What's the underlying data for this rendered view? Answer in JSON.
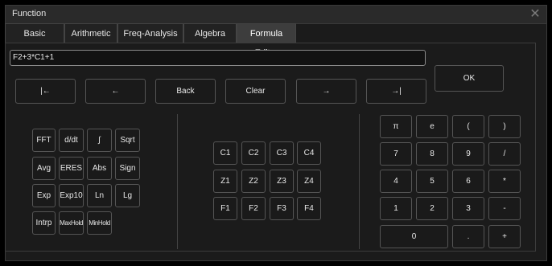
{
  "window": {
    "title": "Function",
    "close_glyph": "✕"
  },
  "tabs": [
    {
      "label": "Basic"
    },
    {
      "label": "Arithmetic"
    },
    {
      "label": "Freq-Analysis"
    },
    {
      "label": "Algebra"
    },
    {
      "label": "Formula Editor"
    }
  ],
  "active_tab": "Formula Editor",
  "expression": {
    "value": "F2+3*C1+1"
  },
  "edit_buttons": [
    {
      "label": "|←"
    },
    {
      "label": "←"
    },
    {
      "label": "Back"
    },
    {
      "label": "Clear"
    },
    {
      "label": "→"
    },
    {
      "label": "→|"
    }
  ],
  "ok_label": "OK",
  "functions": [
    [
      "FFT",
      "d/dt",
      "∫",
      "Sqrt"
    ],
    [
      "Avg",
      "ERES",
      "Abs",
      "Sign"
    ],
    [
      "Exp",
      "Exp10",
      "Ln",
      "Lg"
    ],
    [
      "Intrp",
      "MaxHold",
      "MinHold"
    ]
  ],
  "sources": [
    [
      "C1",
      "C2",
      "C3",
      "C4"
    ],
    [
      "Z1",
      "Z2",
      "Z3",
      "Z4"
    ],
    [
      "F1",
      "F2",
      "F3",
      "F4"
    ]
  ],
  "keypad": [
    [
      "π",
      "e",
      "(",
      ")"
    ],
    [
      "7",
      "8",
      "9",
      "/"
    ],
    [
      "4",
      "5",
      "6",
      "*"
    ],
    [
      "1",
      "2",
      "3",
      "-"
    ],
    [
      "0",
      ".",
      "+"
    ]
  ]
}
